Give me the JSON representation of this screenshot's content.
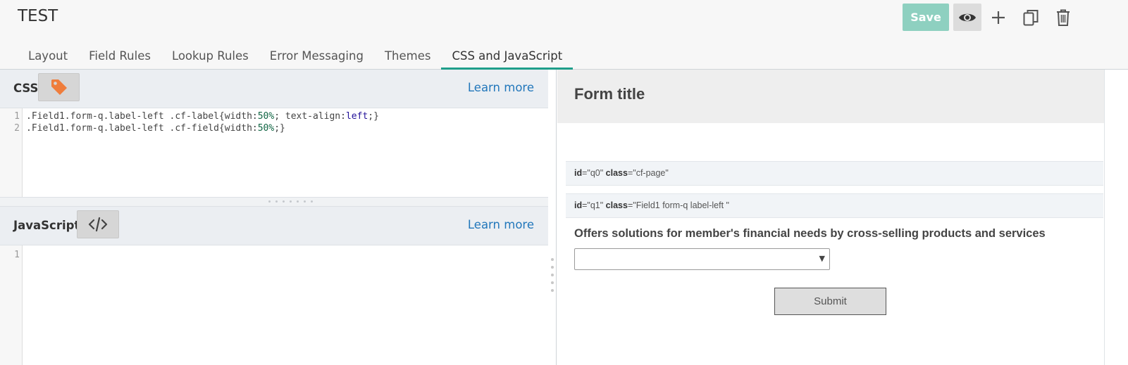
{
  "app": {
    "title": "TEST"
  },
  "toolbar": {
    "save_label": "Save",
    "preview_icon": "eye-icon",
    "add_icon": "plus-icon",
    "copy_icon": "copy-icon",
    "delete_icon": "trash-icon"
  },
  "tabs": [
    {
      "label": "Layout",
      "active": false
    },
    {
      "label": "Field Rules",
      "active": false
    },
    {
      "label": "Lookup Rules",
      "active": false
    },
    {
      "label": "Error Messaging",
      "active": false
    },
    {
      "label": "Themes",
      "active": false
    },
    {
      "label": "CSS and JavaScript",
      "active": true
    }
  ],
  "css_pane": {
    "label": "CSS",
    "tag_icon": "tag-icon",
    "learn_more": "Learn more",
    "line_numbers": [
      "1",
      "2"
    ],
    "lines": [
      ".Field1.form-q.label-left .cf-label{width:50%; text-align:left;}",
      ".Field1.form-q.label-left .cf-field{width:50%;}"
    ]
  },
  "js_pane": {
    "label": "JavaScript",
    "code_icon": "code-icon",
    "learn_more": "Learn more",
    "line_numbers": [
      "1"
    ]
  },
  "preview": {
    "form_title": "Form title",
    "page_debug": {
      "id_key": "id",
      "id_val": "=\"q0\"",
      "class_key": "class",
      "class_val": "=\"cf-page\""
    },
    "field_debug": {
      "id_key": "id",
      "id_val": "=\"q1\"",
      "class_key": "class",
      "class_val": "=\"Field1 form-q label-left \""
    },
    "question": "Offers solutions for member's financial needs by cross-selling products and services",
    "select_value": "",
    "submit_label": "Submit"
  },
  "colors": {
    "accent": "#1f9e8a",
    "save_button": "#8ed0c0",
    "link": "#2277bb",
    "tag_icon": "#ef7d3c"
  }
}
